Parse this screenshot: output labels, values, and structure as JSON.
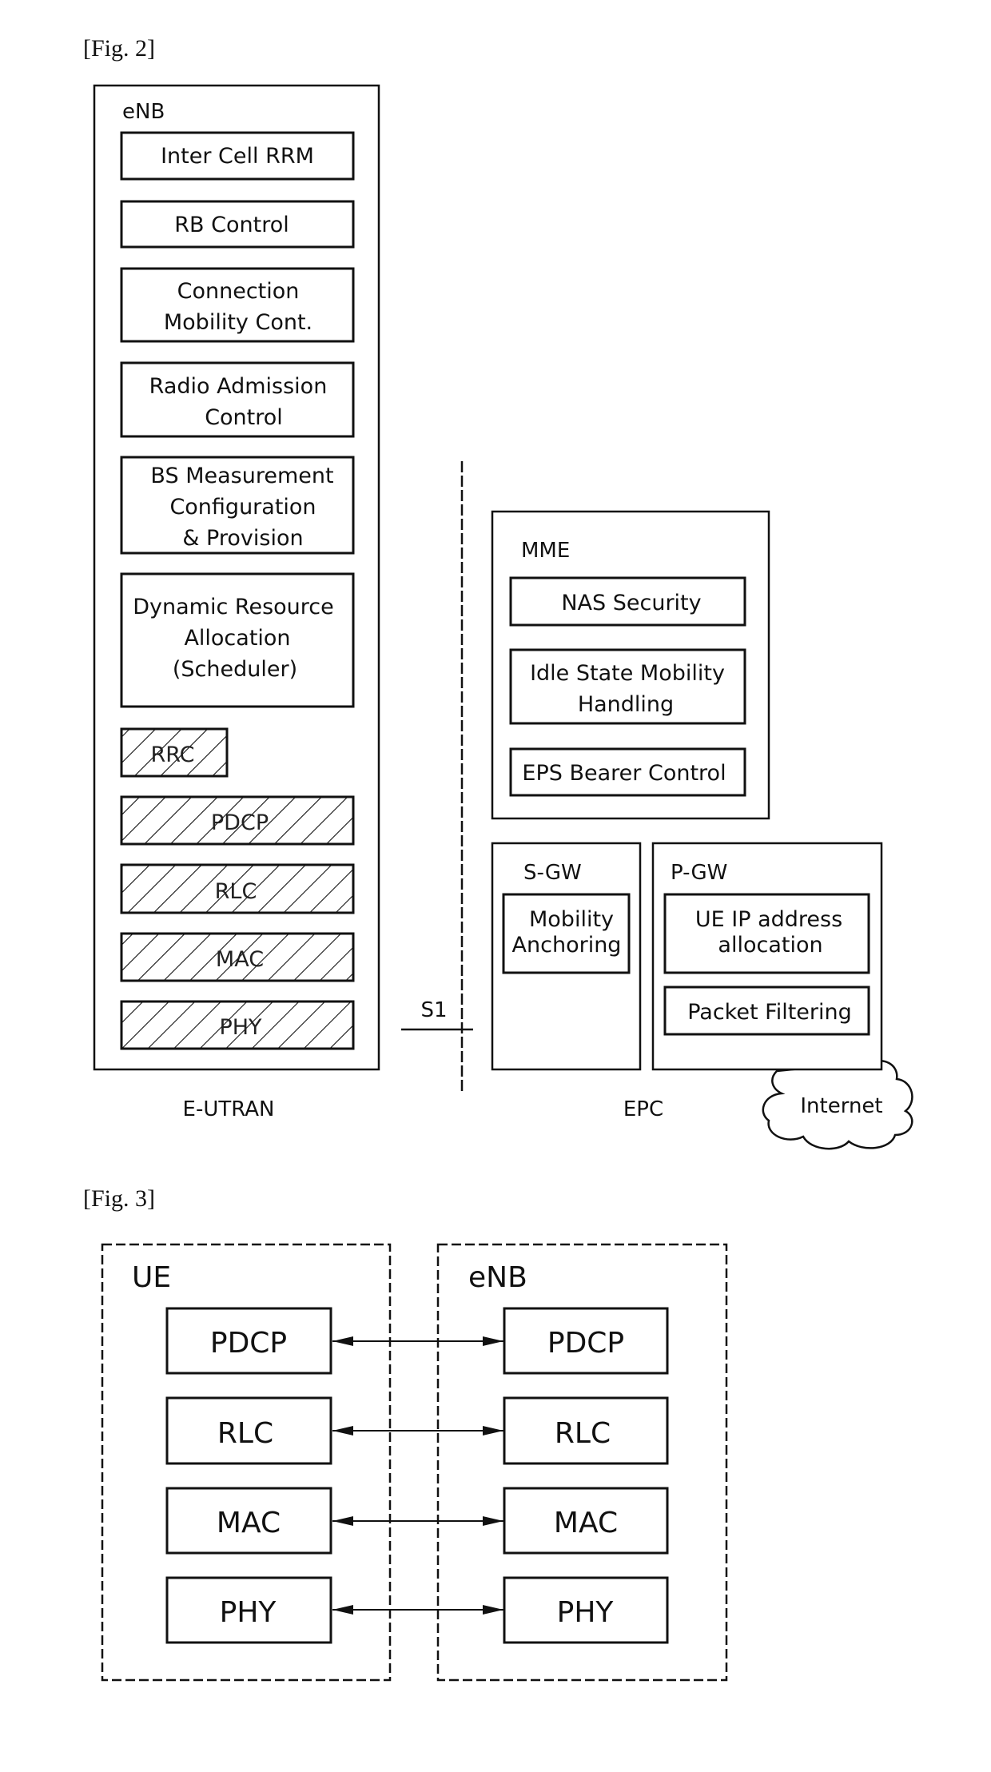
{
  "fig2": {
    "caption": "[Fig. 2]",
    "enb": {
      "title": "eNB",
      "functions": [
        {
          "lines": [
            "Inter Cell RRM"
          ]
        },
        {
          "lines": [
            "RB Control"
          ]
        },
        {
          "lines": [
            "Connection",
            "Mobility Cont."
          ]
        },
        {
          "lines": [
            "Radio Admission",
            "Control"
          ]
        },
        {
          "lines": [
            "BS Measurement",
            "Configuration",
            "& Provision"
          ]
        },
        {
          "lines": [
            "Dynamic Resource",
            "Allocation",
            "(Scheduler)"
          ]
        }
      ],
      "protocol_layers": [
        "RRC",
        "PDCP",
        "RLC",
        "MAC",
        "PHY"
      ]
    },
    "eutran_label": "E-UTRAN",
    "s1_label": "S1",
    "epc_label": "EPC",
    "mme": {
      "title": "MME",
      "functions": [
        {
          "lines": [
            "NAS Security"
          ]
        },
        {
          "lines": [
            "Idle State Mobility",
            "Handling"
          ]
        },
        {
          "lines": [
            "EPS Bearer Control"
          ]
        }
      ]
    },
    "sgw": {
      "title": "S-GW",
      "functions": [
        {
          "lines": [
            "Mobility",
            "Anchoring"
          ]
        }
      ]
    },
    "pgw": {
      "title": "P-GW",
      "functions": [
        {
          "lines": [
            "UE IP address",
            "allocation"
          ]
        },
        {
          "lines": [
            "Packet Filtering"
          ]
        }
      ]
    },
    "internet_label": "Internet"
  },
  "fig3": {
    "caption": "[Fig. 3]",
    "ue": {
      "title": "UE",
      "layers": [
        "PDCP",
        "RLC",
        "MAC",
        "PHY"
      ]
    },
    "enb": {
      "title": "eNB",
      "layers": [
        "PDCP",
        "RLC",
        "MAC",
        "PHY"
      ]
    },
    "links": [
      {
        "from": "UE PDCP",
        "to": "eNB PDCP",
        "direction": "bidirectional"
      },
      {
        "from": "UE RLC",
        "to": "eNB RLC",
        "direction": "bidirectional"
      },
      {
        "from": "UE MAC",
        "to": "eNB MAC",
        "direction": "bidirectional"
      },
      {
        "from": "UE PHY",
        "to": "eNB PHY",
        "direction": "bidirectional"
      }
    ]
  }
}
